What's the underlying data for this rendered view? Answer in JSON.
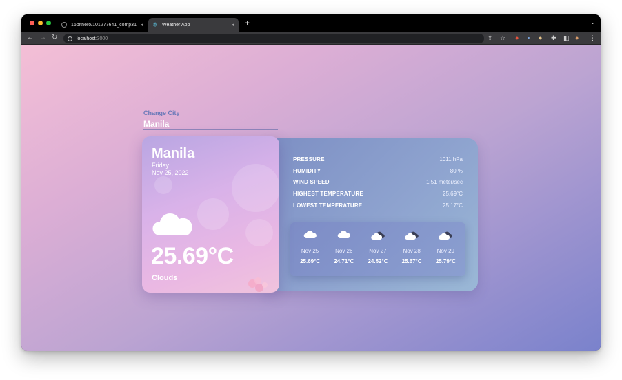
{
  "browser": {
    "tabs": [
      {
        "title": "16bithero/101277641_comp31",
        "active": false
      },
      {
        "title": "Weather App",
        "active": true
      }
    ],
    "new_tab": "+",
    "tab_close": "×",
    "address": {
      "host": "localhost",
      "port": ":3000"
    }
  },
  "search": {
    "label": "Change City",
    "value": "Manila"
  },
  "current": {
    "city": "Manila",
    "day": "Friday",
    "date": "Nov 25, 2022",
    "temperature": "25.69°C",
    "condition": "Clouds",
    "icon": "cloud-icon"
  },
  "details": [
    {
      "label": "PRESSURE",
      "value": "1011 hPa"
    },
    {
      "label": "HUMIDITY",
      "value": "80 %"
    },
    {
      "label": "WIND SPEED",
      "value": "1.51 meter/sec"
    },
    {
      "label": "HIGHEST TEMPERATURE",
      "value": "25.69°C"
    },
    {
      "label": "LOWEST TEMPERATURE",
      "value": "25.17°C"
    }
  ],
  "forecast": [
    {
      "date": "Nov 25",
      "temp": "25.69°C",
      "icon": "cloud-icon"
    },
    {
      "date": "Nov 26",
      "temp": "24.71°C",
      "icon": "cloud-icon"
    },
    {
      "date": "Nov 27",
      "temp": "24.52°C",
      "icon": "broken-clouds-icon"
    },
    {
      "date": "Nov 28",
      "temp": "25.67°C",
      "icon": "broken-clouds-icon"
    },
    {
      "date": "Nov 29",
      "temp": "25.79°C",
      "icon": "broken-clouds-icon"
    }
  ]
}
